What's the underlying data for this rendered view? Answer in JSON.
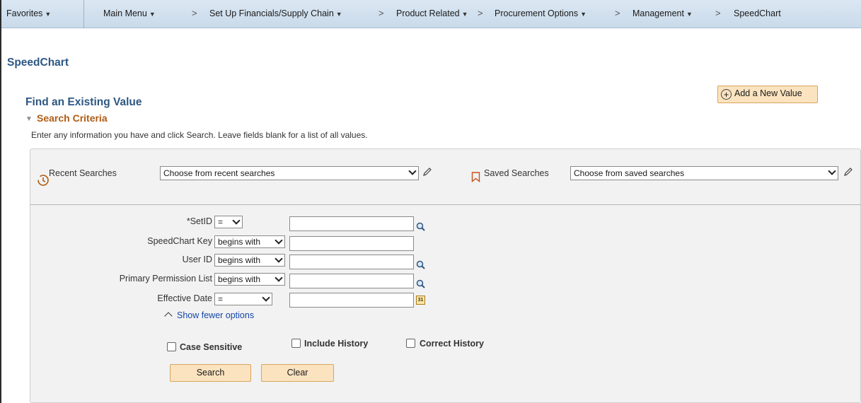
{
  "nav": {
    "favorites": "Favorites",
    "main_menu": "Main Menu",
    "breadcrumbs": [
      "Set Up Financials/Supply Chain",
      "Product Related",
      "Procurement Options",
      "Management",
      "SpeedChart"
    ],
    "separator": ">"
  },
  "page_title": "SpeedChart",
  "find_title": "Find an Existing Value",
  "add_new_label": "Add a New Value",
  "search_criteria": {
    "title": "Search Criteria",
    "instructions": "Enter any information you have and click Search. Leave fields blank for a list of all values."
  },
  "recent_searches": {
    "label": "Recent Searches",
    "value": "Choose from recent searches"
  },
  "saved_searches": {
    "label": "Saved Searches",
    "value": "Choose from saved searches"
  },
  "fields": [
    {
      "label": "*SetID",
      "operator": "=",
      "value": ""
    },
    {
      "label": "SpeedChart Key",
      "operator": "begins with",
      "value": ""
    },
    {
      "label": "User ID",
      "operator": "begins with",
      "value": ""
    },
    {
      "label": "Primary Permission List",
      "operator": "begins with",
      "value": ""
    },
    {
      "label": "Effective Date",
      "operator": "=",
      "value": ""
    }
  ],
  "show_fewer": "Show fewer options",
  "checkboxes": {
    "case_sensitive": "Case Sensitive",
    "include_history": "Include History",
    "correct_history": "Correct History"
  },
  "buttons": {
    "search": "Search",
    "clear": "Clear"
  },
  "calendar_glyph": "31",
  "colors": {
    "title_blue": "#2d5783",
    "criteria_orange": "#b05c14",
    "button_bg": "#fbe3bf",
    "link_blue": "#1546a8"
  }
}
